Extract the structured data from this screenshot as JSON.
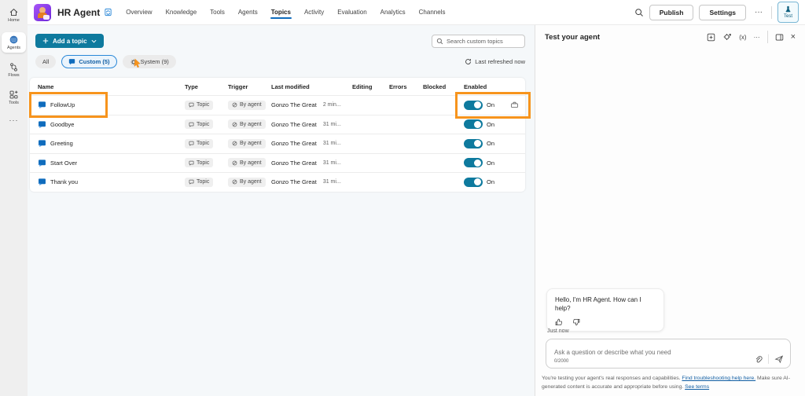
{
  "header": {
    "agent_name": "HR Agent",
    "tabs": [
      "Overview",
      "Knowledge",
      "Tools",
      "Agents",
      "Topics",
      "Activity",
      "Evaluation",
      "Analytics",
      "Channels"
    ],
    "active_tab": "Topics",
    "publish_label": "Publish",
    "settings_label": "Settings",
    "more_label": "···",
    "test_label": "Test"
  },
  "sidebar": {
    "items": [
      "Home",
      "Agents",
      "Flows",
      "Tools"
    ],
    "active_item": "Agents",
    "more_label": "···"
  },
  "topics": {
    "add_topic_label": "Add a topic",
    "search_placeholder": "Search custom topics",
    "refresh_label": "Last refreshed now",
    "filters": {
      "all": "All",
      "custom": "Custom (5)",
      "system": "System (9)"
    },
    "columns": [
      "Name",
      "Type",
      "Trigger",
      "Last modified",
      "Editing",
      "Errors",
      "Blocked",
      "Enabled"
    ],
    "rows": [
      {
        "name": "FollowUp",
        "type": "Topic",
        "trigger": "By agent",
        "modified_by": "Gonzo The Great",
        "modified_time": "2 min...",
        "enabled": "On"
      },
      {
        "name": "Goodbye",
        "type": "Topic",
        "trigger": "By agent",
        "modified_by": "Gonzo The Great",
        "modified_time": "31 mi...",
        "enabled": "On"
      },
      {
        "name": "Greeting",
        "type": "Topic",
        "trigger": "By agent",
        "modified_by": "Gonzo The Great",
        "modified_time": "31 mi...",
        "enabled": "On"
      },
      {
        "name": "Start Over",
        "type": "Topic",
        "trigger": "By agent",
        "modified_by": "Gonzo The Great",
        "modified_time": "31 mi...",
        "enabled": "On"
      },
      {
        "name": "Thank you",
        "type": "Topic",
        "trigger": "By agent",
        "modified_by": "Gonzo The Great",
        "modified_time": "31 mi...",
        "enabled": "On"
      }
    ]
  },
  "test_panel": {
    "title": "Test your agent",
    "variables_glyph": "(x)",
    "more_glyph": "···",
    "message": "Hello, I'm HR Agent. How can I help?",
    "timestamp": "Just now",
    "input_placeholder": "Ask a question or describe what you need",
    "char_counter": "0/2000",
    "disclaimer_part1": "You're testing your agent's real responses and capabilities. ",
    "troubleshoot_link": "Find troubleshooting help here.",
    "disclaimer_part2": " Make sure AI-generated content is accurate and appropriate before using. ",
    "terms_link": "See terms"
  },
  "colors": {
    "accent_blue": "#0f6cbd",
    "primary_teal": "#0e7a9e",
    "annotation_orange": "#f7941d"
  }
}
